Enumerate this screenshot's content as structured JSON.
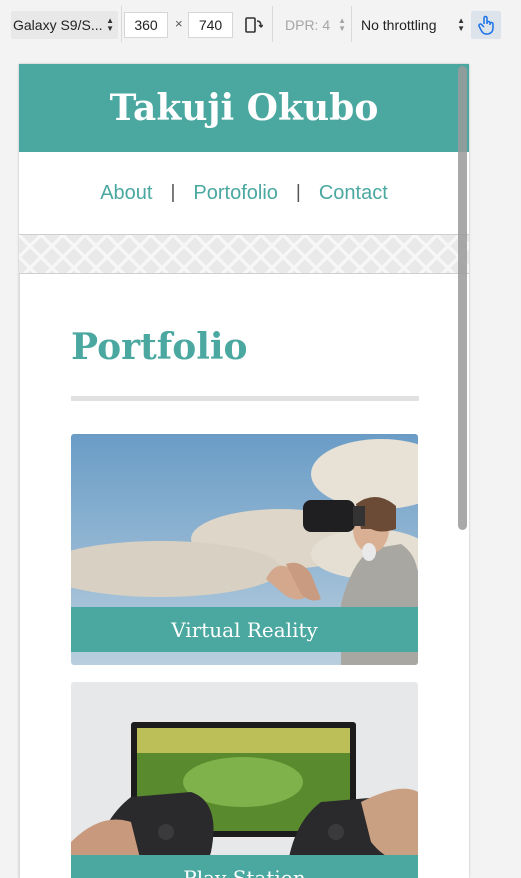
{
  "devtools": {
    "device": "Galaxy S9/S...",
    "width": "360",
    "times": "×",
    "height": "740",
    "dpr": "DPR: 4",
    "throttling": "No throttling",
    "icons": [
      "rotate-icon",
      "touch-icon"
    ]
  },
  "site": {
    "title": "Takuji Okubo",
    "nav": [
      {
        "label": "About"
      },
      {
        "label": "Portofolio"
      },
      {
        "label": "Contact"
      }
    ],
    "separator": "|",
    "section_title": "Portfolio",
    "cards": [
      {
        "label": "Virtual Reality"
      },
      {
        "label": "Play Station"
      }
    ]
  },
  "colors": {
    "accent": "#4aa8a0",
    "toolbar_bg": "#f3f3f3"
  }
}
